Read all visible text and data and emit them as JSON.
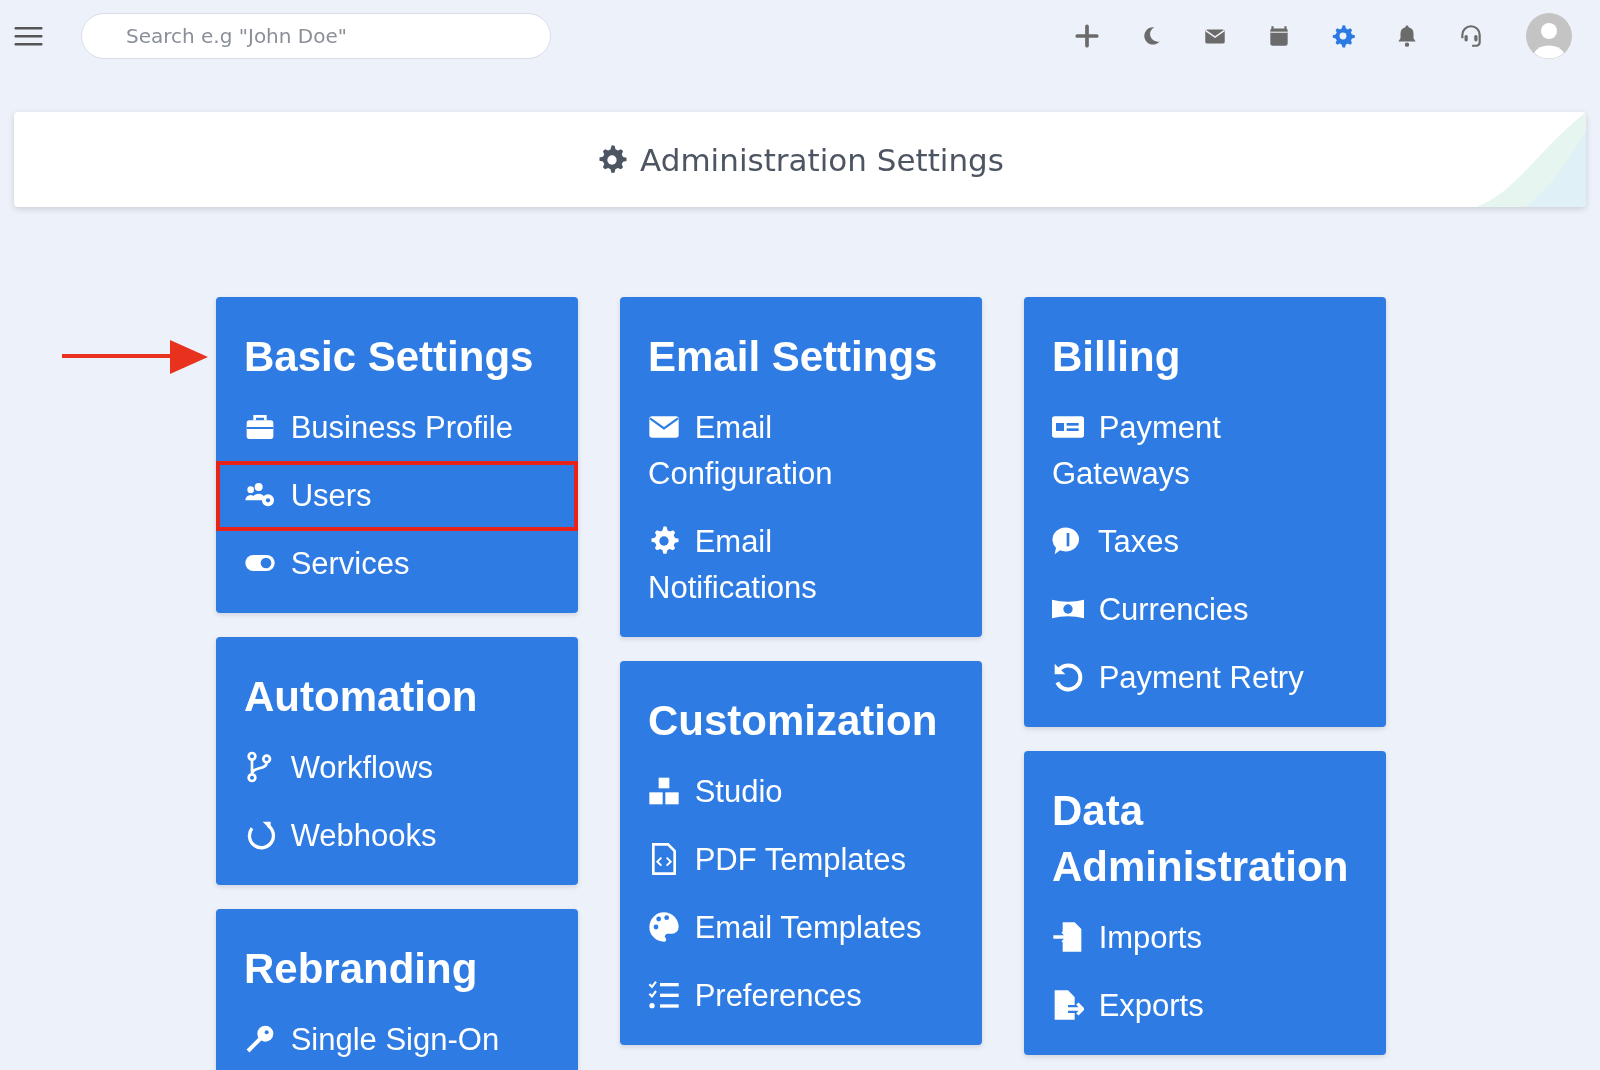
{
  "search": {
    "placeholder": "Search e.g \"John Doe\""
  },
  "header": {
    "title": "Administration Settings"
  },
  "pointer_arrow": true,
  "columns": [
    [
      {
        "title": "Basic Settings",
        "items": [
          {
            "label": "Business Profile",
            "highlighted": false
          },
          {
            "label": "Users",
            "highlighted": true
          },
          {
            "label": "Services",
            "highlighted": false
          }
        ]
      },
      {
        "title": "Automation",
        "items": [
          {
            "label": "Workflows",
            "highlighted": false
          },
          {
            "label": "Webhooks",
            "highlighted": false
          }
        ]
      },
      {
        "title": "Rebranding",
        "items": [
          {
            "label": "Single Sign-On",
            "highlighted": false
          }
        ]
      }
    ],
    [
      {
        "title": "Email Settings",
        "items": [
          {
            "label": "Email Configuration",
            "highlighted": false
          },
          {
            "label": "Email Notifications",
            "highlighted": false
          }
        ]
      },
      {
        "title": "Customization",
        "items": [
          {
            "label": "Studio",
            "highlighted": false
          },
          {
            "label": "PDF Templates",
            "highlighted": false
          },
          {
            "label": "Email Templates",
            "highlighted": false
          },
          {
            "label": "Preferences",
            "highlighted": false
          }
        ]
      }
    ],
    [
      {
        "title": "Billing",
        "items": [
          {
            "label": "Payment Gateways",
            "highlighted": false
          },
          {
            "label": "Taxes",
            "highlighted": false
          },
          {
            "label": "Currencies",
            "highlighted": false
          },
          {
            "label": "Payment Retry",
            "highlighted": false
          }
        ]
      },
      {
        "title": "Data Administration",
        "items": [
          {
            "label": "Imports",
            "highlighted": false
          },
          {
            "label": "Exports",
            "highlighted": false
          }
        ]
      }
    ]
  ]
}
